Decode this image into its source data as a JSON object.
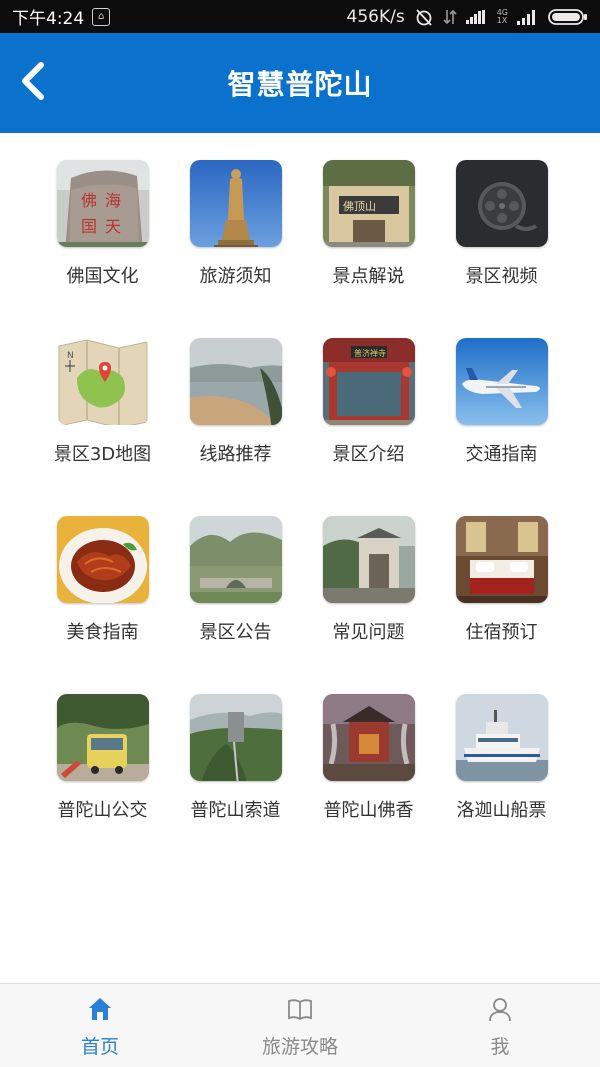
{
  "status_bar": {
    "time": "下午4:24",
    "network_speed": "456K/s",
    "network_type": "4G",
    "network_sub": "1X"
  },
  "header": {
    "title": "智慧普陀山",
    "back_icon": "chevron-left-icon",
    "background_color": "#0a72cc"
  },
  "grid": {
    "items": [
      {
        "label": "佛国文化",
        "image": "stone-calligraphy-photo"
      },
      {
        "label": "旅游须知",
        "image": "guanyin-statue-photo"
      },
      {
        "label": "景点解说",
        "image": "temple-gate-photo"
      },
      {
        "label": "景区视频",
        "image": "film-reel-icon"
      },
      {
        "label": "景区3D地图",
        "image": "map-icon"
      },
      {
        "label": "线路推荐",
        "image": "beach-photo"
      },
      {
        "label": "景区介绍",
        "image": "temple-hall-photo"
      },
      {
        "label": "交通指南",
        "image": "airplane-photo"
      },
      {
        "label": "美食指南",
        "image": "food-dish-photo"
      },
      {
        "label": "景区公告",
        "image": "stone-bridge-photo"
      },
      {
        "label": "常见问题",
        "image": "garden-gate-photo"
      },
      {
        "label": "住宿预订",
        "image": "hotel-room-photo"
      },
      {
        "label": "普陀山公交",
        "image": "bus-photo"
      },
      {
        "label": "普陀山索道",
        "image": "cableway-photo"
      },
      {
        "label": "普陀山佛香",
        "image": "incense-photo"
      },
      {
        "label": "洛迦山船票",
        "image": "ferry-photo"
      }
    ]
  },
  "bottom_nav": {
    "items": [
      {
        "label": "首页",
        "icon": "home-icon",
        "active": true
      },
      {
        "label": "旅游攻略",
        "icon": "book-icon",
        "active": false
      },
      {
        "label": "我",
        "icon": "person-icon",
        "active": false
      }
    ],
    "active_color": "#2c7fd6",
    "inactive_color": "#8a8a8a"
  }
}
